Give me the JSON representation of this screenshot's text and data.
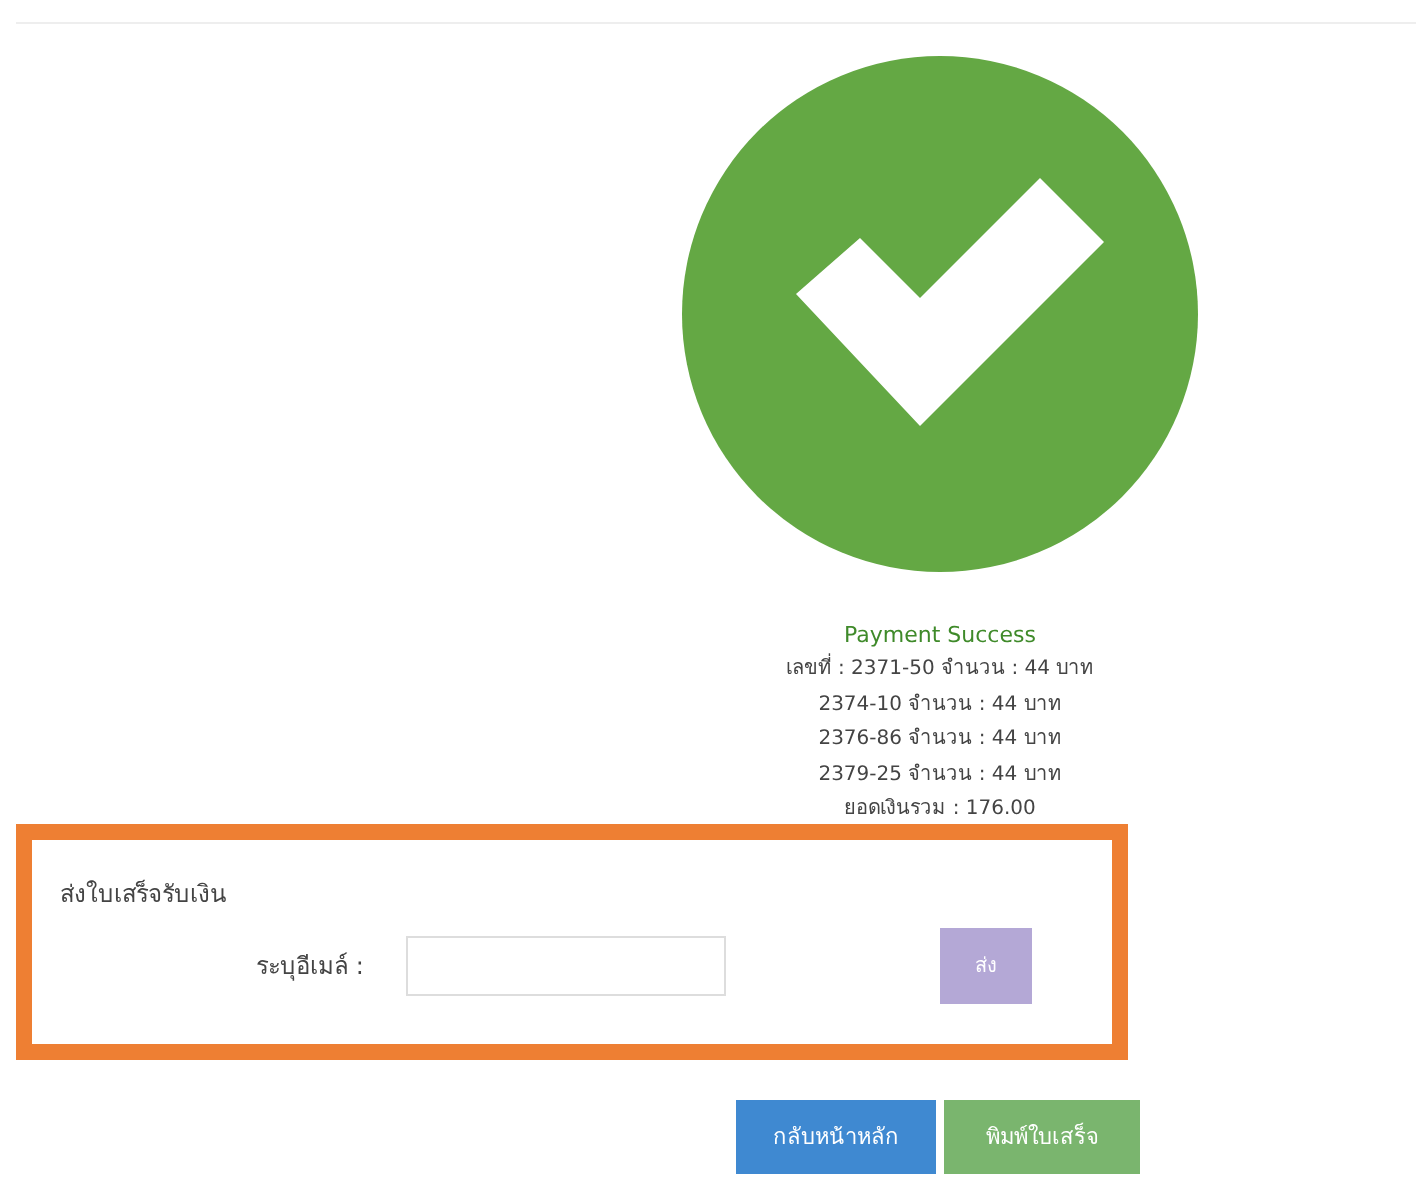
{
  "result": {
    "title": "Payment Success",
    "lines": [
      "เลขที่ : 2371-50 จำนวน : 44 บาท",
      "2374-10 จำนวน : 44 บาท",
      "2376-86 จำนวน : 44 บาท",
      "2379-25 จำนวน : 44 บาท",
      "ยอดเงินรวม : 176.00"
    ]
  },
  "receipt": {
    "heading": "ส่งใบเสร็จรับเงิน",
    "email_label": "ระบุอีเมล์ :",
    "send_button": "ส่ง"
  },
  "buttons": [
    "กลับหน้าหลัก",
    "พิมพ์ใบเสร็จ"
  ]
}
